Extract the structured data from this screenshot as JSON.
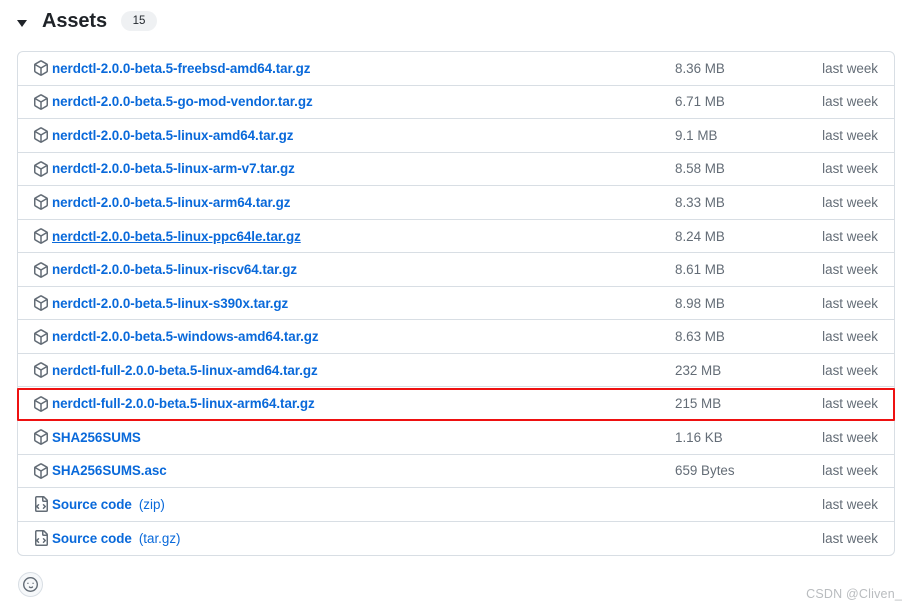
{
  "header": {
    "title": "Assets",
    "count": "15",
    "disclosure_icon": "triangle-down-icon"
  },
  "table": {
    "rows": [
      {
        "icon": "package-icon",
        "name": "nerdctl-2.0.0-beta.5-freebsd-amd64.tar.gz",
        "suffix": "",
        "size": "8.36 MB",
        "date": "last week",
        "hovered": false,
        "highlighted": false
      },
      {
        "icon": "package-icon",
        "name": "nerdctl-2.0.0-beta.5-go-mod-vendor.tar.gz",
        "suffix": "",
        "size": "6.71 MB",
        "date": "last week",
        "hovered": false,
        "highlighted": false
      },
      {
        "icon": "package-icon",
        "name": "nerdctl-2.0.0-beta.5-linux-amd64.tar.gz",
        "suffix": "",
        "size": "9.1 MB",
        "date": "last week",
        "hovered": false,
        "highlighted": false
      },
      {
        "icon": "package-icon",
        "name": "nerdctl-2.0.0-beta.5-linux-arm-v7.tar.gz",
        "suffix": "",
        "size": "8.58 MB",
        "date": "last week",
        "hovered": false,
        "highlighted": false
      },
      {
        "icon": "package-icon",
        "name": "nerdctl-2.0.0-beta.5-linux-arm64.tar.gz",
        "suffix": "",
        "size": "8.33 MB",
        "date": "last week",
        "hovered": false,
        "highlighted": false
      },
      {
        "icon": "package-icon",
        "name": "nerdctl-2.0.0-beta.5-linux-ppc64le.tar.gz",
        "suffix": "",
        "size": "8.24 MB",
        "date": "last week",
        "hovered": true,
        "highlighted": false
      },
      {
        "icon": "package-icon",
        "name": "nerdctl-2.0.0-beta.5-linux-riscv64.tar.gz",
        "suffix": "",
        "size": "8.61 MB",
        "date": "last week",
        "hovered": false,
        "highlighted": false
      },
      {
        "icon": "package-icon",
        "name": "nerdctl-2.0.0-beta.5-linux-s390x.tar.gz",
        "suffix": "",
        "size": "8.98 MB",
        "date": "last week",
        "hovered": false,
        "highlighted": false
      },
      {
        "icon": "package-icon",
        "name": "nerdctl-2.0.0-beta.5-windows-amd64.tar.gz",
        "suffix": "",
        "size": "8.63 MB",
        "date": "last week",
        "hovered": false,
        "highlighted": false
      },
      {
        "icon": "package-icon",
        "name": "nerdctl-full-2.0.0-beta.5-linux-amd64.tar.gz",
        "suffix": "",
        "size": "232 MB",
        "date": "last week",
        "hovered": false,
        "highlighted": false
      },
      {
        "icon": "package-icon",
        "name": "nerdctl-full-2.0.0-beta.5-linux-arm64.tar.gz",
        "suffix": "",
        "size": "215 MB",
        "date": "last week",
        "hovered": false,
        "highlighted": true
      },
      {
        "icon": "package-icon",
        "name": "SHA256SUMS",
        "suffix": "",
        "size": "1.16 KB",
        "date": "last week",
        "hovered": false,
        "highlighted": false
      },
      {
        "icon": "package-icon",
        "name": "SHA256SUMS.asc",
        "suffix": "",
        "size": "659 Bytes",
        "date": "last week",
        "hovered": false,
        "highlighted": false
      },
      {
        "icon": "file-code-icon",
        "name": "Source code",
        "suffix": "(zip)",
        "size": "",
        "date": "last week",
        "hovered": false,
        "highlighted": false
      },
      {
        "icon": "file-code-icon",
        "name": "Source code",
        "suffix": "(tar.gz)",
        "size": "",
        "date": "last week",
        "hovered": false,
        "highlighted": false
      }
    ]
  },
  "footer": {
    "reaction_icon": "smiley-icon",
    "watermark": "CSDN @Cliven_"
  },
  "colors": {
    "link": "#0969da",
    "muted": "#636c76",
    "border": "#d8dee4",
    "highlight": "#ee1111"
  }
}
